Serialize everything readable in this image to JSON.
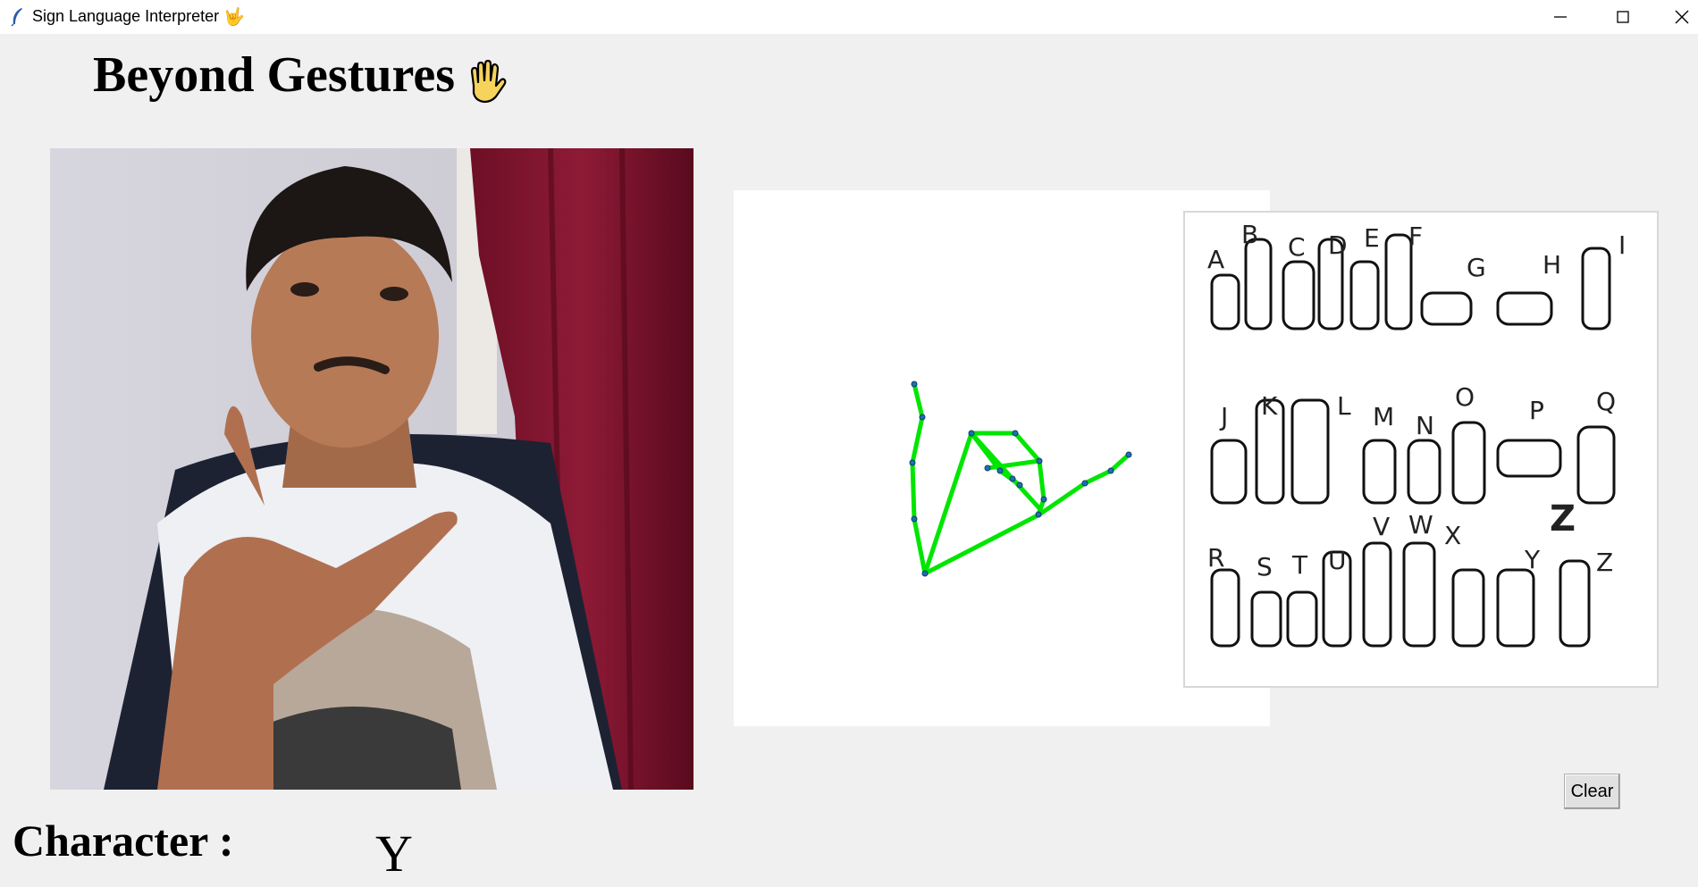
{
  "window": {
    "title": "Sign Language Interpreter",
    "title_glyph": "🤟",
    "controls": [
      "minimize",
      "maximize",
      "close"
    ]
  },
  "heading": {
    "text": "Beyond Gestures",
    "icon": "raised-hand-icon"
  },
  "camera_feed": {
    "description_icon": "webcam-frame"
  },
  "asl_chart": {
    "letters": [
      "A",
      "B",
      "C",
      "D",
      "E",
      "F",
      "G",
      "H",
      "I",
      "J",
      "K",
      "L",
      "M",
      "N",
      "O",
      "P",
      "Q",
      "R",
      "S",
      "T",
      "U",
      "V",
      "W",
      "X",
      "Y",
      "Z",
      "Z"
    ]
  },
  "actions": {
    "clear_label": "Clear"
  },
  "output": {
    "label": "Character :",
    "value": "Y"
  },
  "colors": {
    "skeleton_line": "#00e600",
    "joint": "#1f6fb0",
    "accent": "#000000"
  }
}
